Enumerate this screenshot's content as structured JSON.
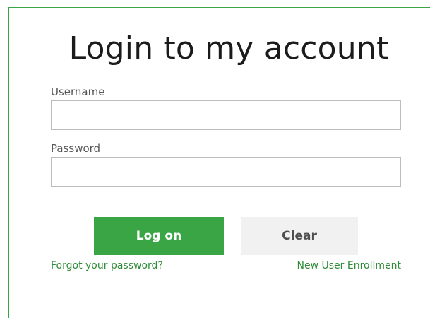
{
  "login": {
    "title": "Login to my account",
    "username_label": "Username",
    "username_value": "",
    "password_label": "Password",
    "password_value": "",
    "logon_label": "Log on",
    "clear_label": "Clear",
    "forgot_link": "Forgot your password?",
    "enroll_link": "New User Enrollment"
  },
  "colors": {
    "accent": "#3aa545",
    "link": "#2e8b38",
    "clear_button_bg": "#f0f1f0",
    "input_border": "#bdbdbd"
  }
}
